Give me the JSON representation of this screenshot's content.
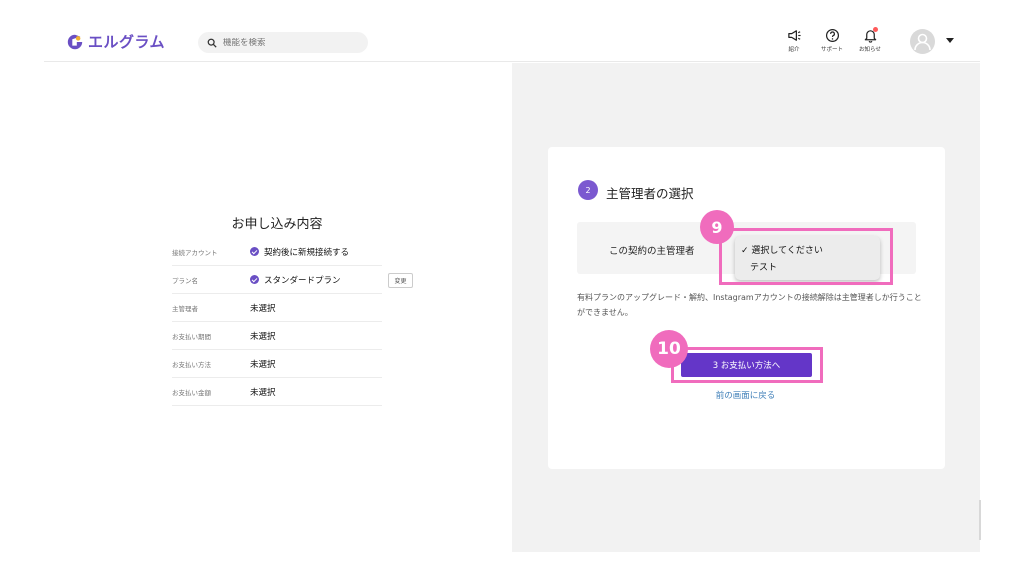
{
  "header": {
    "logo_text": "エルグラム",
    "search_placeholder": "機能を検索",
    "icons": [
      {
        "name": "megaphone-icon",
        "label": "紹介"
      },
      {
        "name": "help-circle-icon",
        "label": "サポート"
      },
      {
        "name": "bell-icon",
        "label": "お知らせ"
      }
    ],
    "brand_color": "#6a4fc4"
  },
  "summary": {
    "title": "お申し込み内容",
    "rows": [
      {
        "key": "接続アカウント",
        "value": "契約後に新規接続する",
        "checked": true
      },
      {
        "key": "プラン名",
        "value": "スタンダードプラン",
        "checked": true,
        "action": "変更"
      },
      {
        "key": "主管理者",
        "value": "未選択",
        "checked": false
      },
      {
        "key": "お支払い期間",
        "value": "未選択",
        "checked": false
      },
      {
        "key": "お支払い方法",
        "value": "未選択",
        "checked": false
      },
      {
        "key": "お支払い金額",
        "value": "未選択",
        "checked": false
      }
    ]
  },
  "step": {
    "number": "2",
    "title": "主管理者の選択",
    "select_label": "この契約の主管理者",
    "options": [
      {
        "label": "✓ 選択してください",
        "selected": true
      },
      {
        "label": "テスト",
        "selected": false
      }
    ],
    "note": "有料プランのアップグレード・解約、Instagramアカウントの接続解除は主管理者しか行うことができません。",
    "primary_button": "3 お支払い方法へ",
    "back_link": "前の画面に戻る"
  },
  "annotations": {
    "marker_9": "9",
    "marker_10": "10",
    "highlight_color": "#f06cbd"
  },
  "colors": {
    "button": "#6436c8",
    "link": "#3f7fb8"
  }
}
